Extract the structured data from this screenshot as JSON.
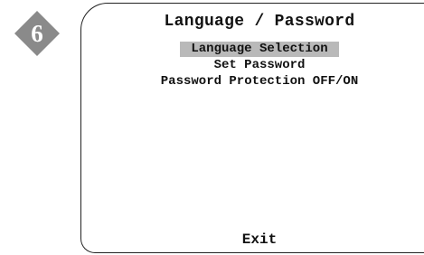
{
  "step": {
    "number": "6",
    "badge_color": "#8a8a8a",
    "number_color": "#ffffff"
  },
  "menu": {
    "title": "Language / Password",
    "items": [
      {
        "label": "Language Selection",
        "selected": true
      },
      {
        "label": "Set Password",
        "selected": false
      },
      {
        "label": "Password Protection OFF/ON",
        "selected": false
      }
    ],
    "exit_label": "Exit",
    "highlight_color": "#b9b9b9"
  }
}
